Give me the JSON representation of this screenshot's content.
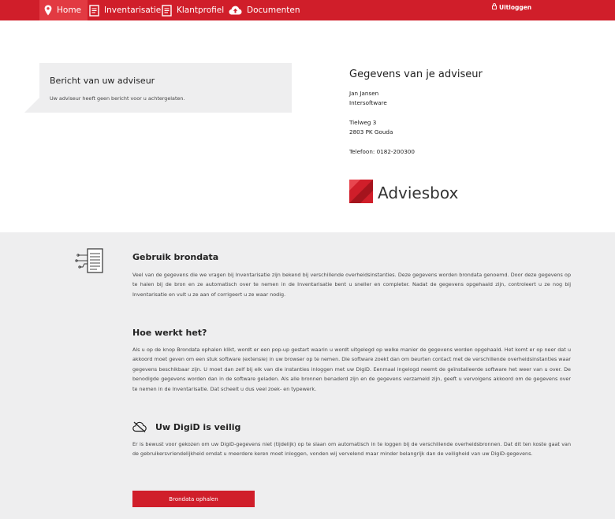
{
  "nav": {
    "items": [
      {
        "label": "Home",
        "icon": "map-pin-icon"
      },
      {
        "label": "Inventarisatie",
        "icon": "document-icon"
      },
      {
        "label": "Klantprofiel",
        "icon": "document-icon"
      },
      {
        "label": "Documenten",
        "icon": "cloud-upload-icon"
      }
    ],
    "logout_label": "Uitloggen",
    "logout_icon": "lock-icon"
  },
  "message": {
    "title": "Bericht van uw adviseur",
    "text": "Uw adviseur heeft geen bericht voor u achtergelaten."
  },
  "adviser": {
    "heading": "Gegevens van je adviseur",
    "name": "Jan Jansen",
    "company": "Intersoftware",
    "street": "Tielweg 3",
    "city": "2803 PK Gouda",
    "phone": "Telefoon: 0182-200300",
    "logo_text": "Adviesbox"
  },
  "info": {
    "section1_title": "Gebruik brondata",
    "section1_text": "Veel van de gegevens die we vragen bij Inventarisatie zijn bekend bij verschillende overheidsinstanties. Deze gegevens worden brondata genoemd. Door deze gegevens op te halen bij de bron en ze automatisch over te nemen in de Inventarisatie bent u sneller en completer. Nadat de gegevens opgehaald zijn, controleert u ze nog bij Inventarisatie en vult u ze aan of corrigeert u ze waar nodig.",
    "section2_title": "Hoe werkt het?",
    "section2_text": "Als u op de knop Brondata ophalen klikt, wordt er een pop-up gestart waarin u wordt uitgelegd op welke manier de gegevens worden opgehaald. Het komt er op neer dat u akkoord moet geven om een stuk software (extensie) in uw browser op te nemen. Die software zoekt dan om beurten contact met de verschillende overheidsinstanties waar gegevens beschikbaar zijn. U moet dan zelf bij elk van die instanties inloggen met uw DigiD. Eenmaal ingelogd neemt de geïnstalleerde software het weer van u over. De benodigde gegevens worden dan in de software geladen. Als alle bronnen benaderd zijn en de gegevens verzameld zijn, geeft u vervolgens akkoord om de gegevens over te nemen in de Inventarisatie. Dat scheelt u dus veel zoek- en typewerk.",
    "section3_title": "Uw DigiD is veilig",
    "section3_text": "Er is bewust voor gekozen om uw DigiD-gegevens niet (tijdelijk) op te slaan om automatisch in te loggen bij de verschillende overheidsbronnen. Dat dit ten koste gaat van de gebruikersvriendelijkheid omdat u meerdere keren moet inloggen, vonden wij vervelend maar minder belangrijk dan de veiligheid van uw DigiD-gegevens.",
    "button_label": "Brondata ophalen"
  },
  "colors": {
    "brand_red": "#d01e2a",
    "active_nav": "#e23a42",
    "panel_grey": "#eeeeef"
  }
}
